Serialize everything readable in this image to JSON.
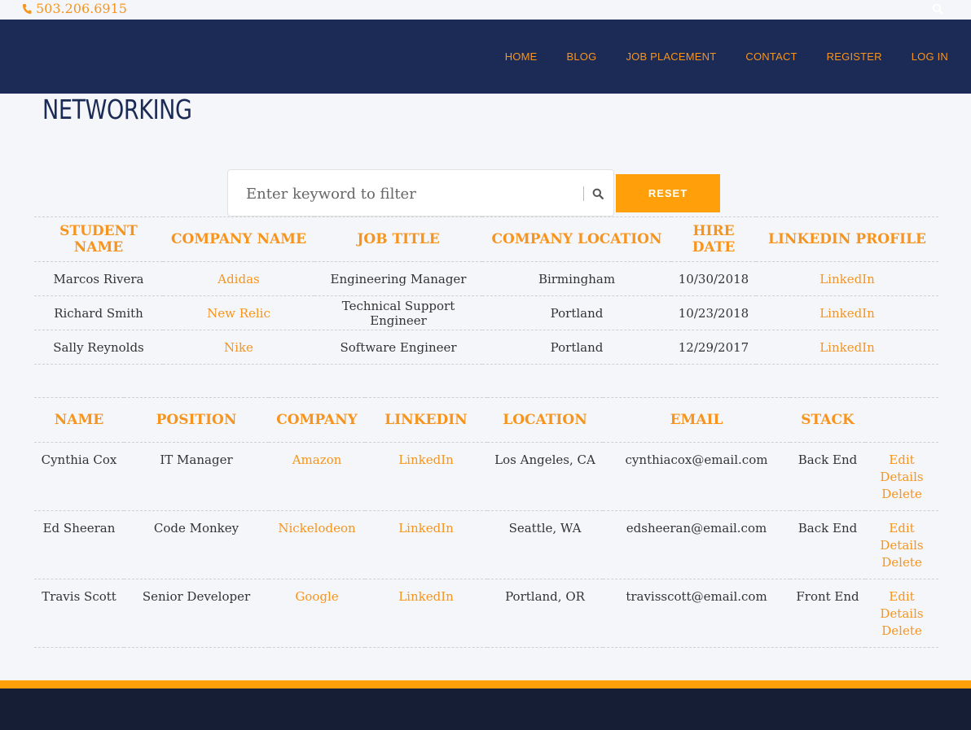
{
  "topbar": {
    "phone": "503.206.6915"
  },
  "nav": {
    "items": [
      "HOME",
      "BLOG",
      "JOB PLACEMENT",
      "CONTACT",
      "REGISTER",
      "LOG IN"
    ]
  },
  "page": {
    "title": "NETWORKING"
  },
  "filter": {
    "placeholder": "Enter keyword to filter",
    "reset_label": "RESET"
  },
  "placements": {
    "headers": [
      "STUDENT NAME",
      "COMPANY NAME",
      "JOB TITLE",
      "COMPANY LOCATION",
      "HIRE DATE",
      "LINKEDIN PROFILE"
    ],
    "rows": [
      {
        "student": "Marcos Rivera",
        "company": "Adidas",
        "title": "Engineering Manager",
        "location": "Birmingham",
        "date": "10/30/2018",
        "linkedin": "LinkedIn"
      },
      {
        "student": "Richard Smith",
        "company": "New Relic",
        "title": "Technical Support Engineer",
        "location": "Portland",
        "date": "10/23/2018",
        "linkedin": "LinkedIn"
      },
      {
        "student": "Sally Reynolds",
        "company": "Nike",
        "title": "Software Engineer",
        "location": "Portland",
        "date": "12/29/2017",
        "linkedin": "LinkedIn"
      }
    ]
  },
  "contacts": {
    "headers": [
      "NAME",
      "POSITION",
      "COMPANY",
      "LINKEDIN",
      "LOCATION",
      "EMAIL",
      "STACK",
      ""
    ],
    "actions": {
      "edit": "Edit",
      "details": "Details",
      "delete": "Delete"
    },
    "rows": [
      {
        "name": "Cynthia Cox",
        "position": "IT Manager",
        "company": "Amazon",
        "linkedin": "LinkedIn",
        "location": "Los Angeles, CA",
        "email": "cynthiacox@email.com",
        "stack": "Back End"
      },
      {
        "name": "Ed Sheeran",
        "position": "Code Monkey",
        "company": "Nickelodeon",
        "linkedin": "LinkedIn",
        "location": "Seattle, WA",
        "email": "edsheeran@email.com",
        "stack": "Back End"
      },
      {
        "name": "Travis Scott",
        "position": "Senior Developer",
        "company": "Google",
        "linkedin": "LinkedIn",
        "location": "Portland, OR",
        "email": "travisscott@email.com",
        "stack": "Front End"
      }
    ]
  },
  "colors": {
    "navy": "#1c2b55",
    "accent": "#f7941d",
    "button": "#ff9f0a",
    "footer": "#161e35"
  }
}
